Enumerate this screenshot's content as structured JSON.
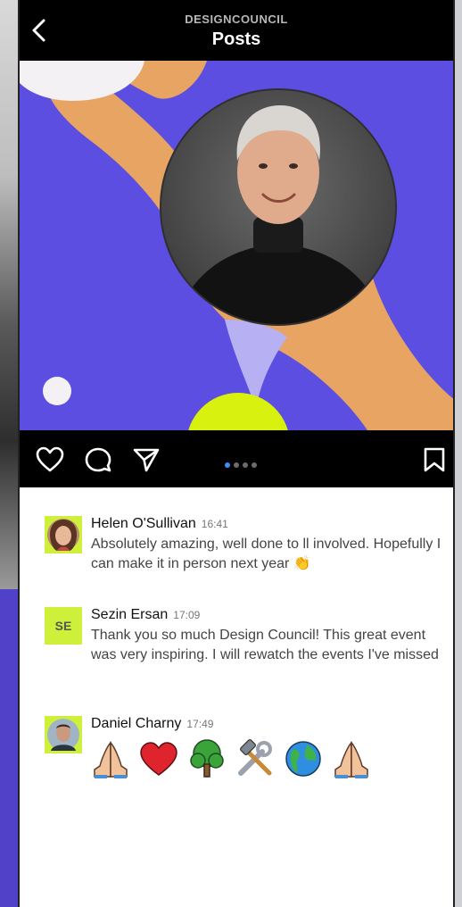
{
  "header": {
    "subtitle": "DESIGNCOUNCIL",
    "title": "Posts"
  },
  "post": {
    "carousel_pages": 4,
    "carousel_active_index": 0,
    "colors": {
      "background": "#5b4ee0",
      "accent_orange": "#e7a463",
      "accent_lime": "#d9f10f",
      "accent_lavender": "#b7b0f2",
      "blob_white": "#f3f1f4"
    }
  },
  "actions": {
    "icons": [
      "heart-icon",
      "comment-icon",
      "share-icon",
      "bookmark-icon"
    ]
  },
  "comments": [
    {
      "name": "Helen O'Sullivan",
      "time": "16:41",
      "text": "Absolutely amazing, well done to ll involved. Hopefully I can make it in person next year 👏",
      "avatar_type": "photo"
    },
    {
      "name": "Sezin Ersan",
      "time": "17:09",
      "initials": "SE",
      "text": "Thank you so much Design Council! This great event was very inspiring. I will rewatch the events I've missed",
      "avatar_type": "initials"
    },
    {
      "name": "Daniel Charny",
      "time": "17:49",
      "text": "",
      "emojis": [
        "folded-hands-icon",
        "red-heart-icon",
        "tree-icon",
        "tools-icon",
        "globe-icon",
        "folded-hands-icon"
      ],
      "avatar_type": "photo"
    }
  ]
}
